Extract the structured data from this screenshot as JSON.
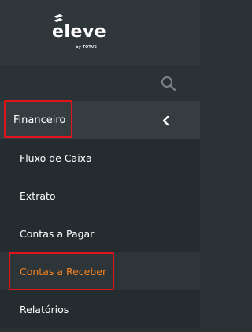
{
  "brand": {
    "name": "eleve",
    "sub": "by TOTVS"
  },
  "search": {
    "icon": "search-icon"
  },
  "section": {
    "label": "Financeiro",
    "expanded": true,
    "icon": "chevron-left-icon"
  },
  "menu": {
    "items": [
      {
        "label": "Fluxo de Caixa"
      },
      {
        "label": "Extrato"
      },
      {
        "label": "Contas a Pagar"
      },
      {
        "label": "Contas a Receber",
        "active": true
      },
      {
        "label": "Relatórios"
      }
    ]
  },
  "colors": {
    "background": "#2b3236",
    "active_text": "#f58220",
    "highlight_border": "#e3131b"
  }
}
